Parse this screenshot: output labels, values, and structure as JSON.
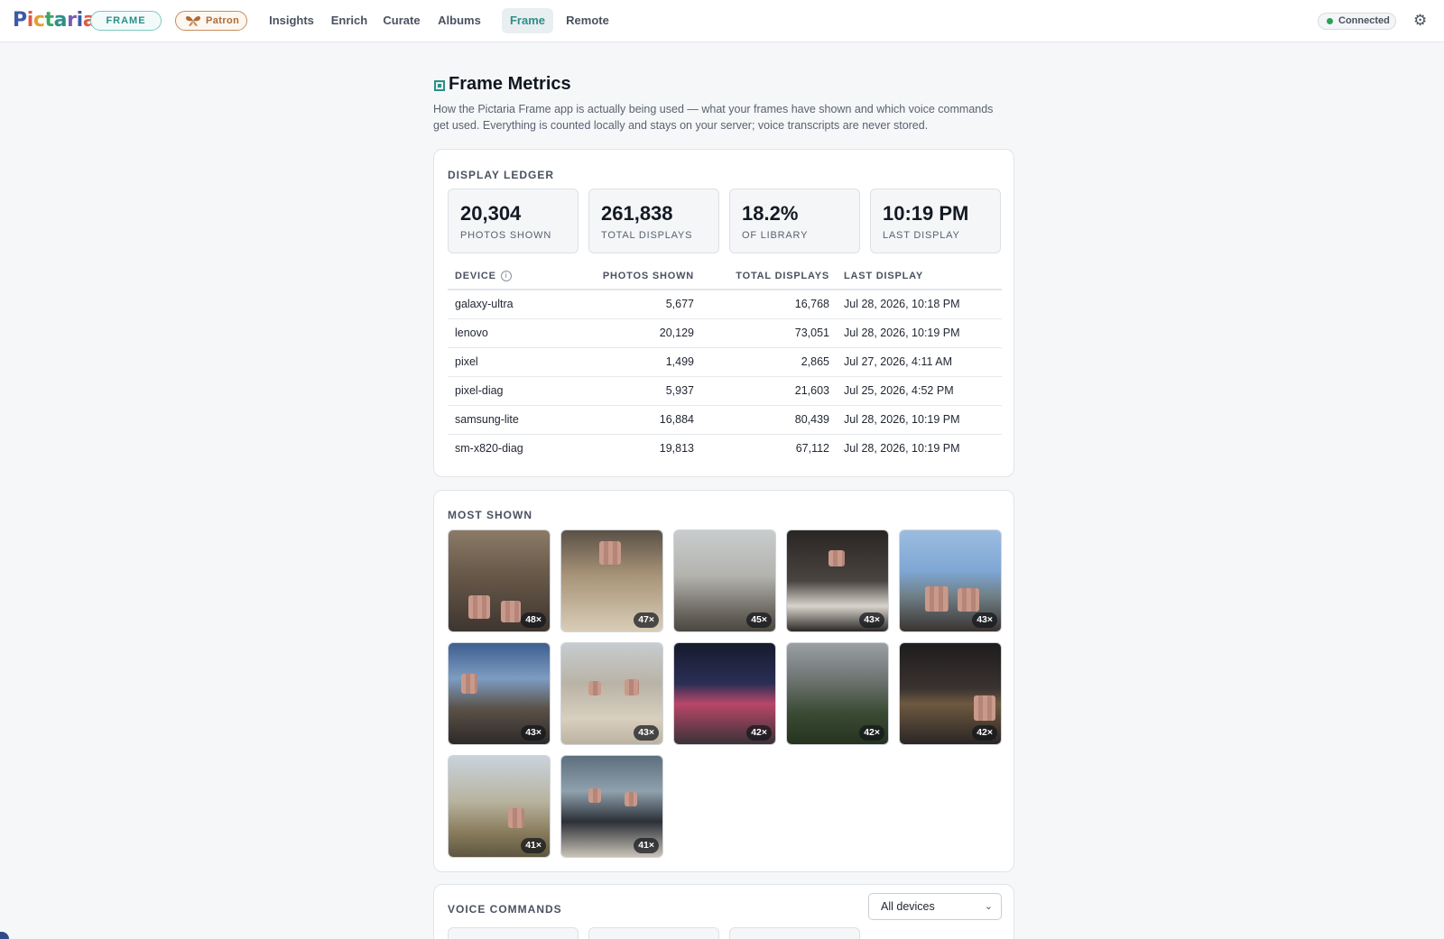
{
  "app": {
    "logo_text": "Pictaria",
    "logo_colors": [
      "#3b5aa8",
      "#e05a4a",
      "#e0a030",
      "#3aa566",
      "#2d8f87",
      "#7a5bb5",
      "#3b5aa8",
      "#e05a4a"
    ],
    "frame_badge": "FRAME",
    "patron_badge": "Patron",
    "nav": [
      "Insights",
      "Enrich",
      "Curate",
      "Albums",
      "Frame",
      "Remote"
    ],
    "active_nav": "Frame",
    "status": "Connected",
    "settings_icon": "gear-icon"
  },
  "page": {
    "title": "Frame Metrics",
    "description": "How the Pictaria Frame app is actually being used — what your frames have shown and which voice commands get used. Everything is counted locally and stays on your server; voice transcripts are never stored."
  },
  "ledger": {
    "heading": "DISPLAY LEDGER",
    "stats": [
      {
        "value": "20,304",
        "label": "PHOTOS SHOWN"
      },
      {
        "value": "261,838",
        "label": "TOTAL DISPLAYS"
      },
      {
        "value": "18.2%",
        "label": "OF LIBRARY"
      },
      {
        "value": "10:19 PM",
        "label": "LAST DISPLAY"
      }
    ],
    "columns": [
      "DEVICE",
      "PHOTOS SHOWN",
      "TOTAL DISPLAYS",
      "LAST DISPLAY"
    ],
    "rows": [
      [
        "galaxy-ultra",
        "5,677",
        "16,768",
        "Jul 28, 2026, 10:18 PM"
      ],
      [
        "lenovo",
        "20,129",
        "73,051",
        "Jul 28, 2026, 10:19 PM"
      ],
      [
        "pixel",
        "1,499",
        "2,865",
        "Jul 27, 2026, 4:11 AM"
      ],
      [
        "pixel-diag",
        "5,937",
        "21,603",
        "Jul 25, 2026, 4:52 PM"
      ],
      [
        "samsung-lite",
        "16,884",
        "80,439",
        "Jul 28, 2026, 10:19 PM"
      ],
      [
        "sm-x820-diag",
        "19,813",
        "67,112",
        "Jul 28, 2026, 10:19 PM"
      ]
    ]
  },
  "most_shown": {
    "heading": "MOST SHOWN",
    "photos": [
      {
        "count": "48×",
        "scene": "clock-tower-street"
      },
      {
        "count": "47×",
        "scene": "person-reading-menu"
      },
      {
        "count": "45×",
        "scene": "city-rooftops"
      },
      {
        "count": "43×",
        "scene": "wedding-night"
      },
      {
        "count": "43×",
        "scene": "river-cathedral-selfie"
      },
      {
        "count": "43×",
        "scene": "cafe-terrace"
      },
      {
        "count": "43×",
        "scene": "beach-children"
      },
      {
        "count": "42×",
        "scene": "ferris-wheel-group"
      },
      {
        "count": "42×",
        "scene": "hillside-town"
      },
      {
        "count": "42×",
        "scene": "night-selfie"
      },
      {
        "count": "41×",
        "scene": "riverbank-portrait"
      },
      {
        "count": "41×",
        "scene": "restaurant-couple"
      }
    ]
  },
  "voice": {
    "heading": "VOICE COMMANDS",
    "device_filter": "All devices"
  }
}
